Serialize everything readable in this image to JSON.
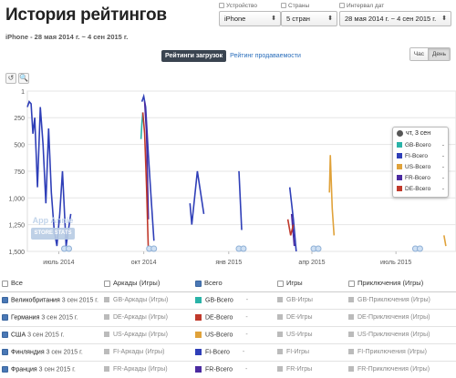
{
  "header": {
    "title": "История рейтингов",
    "subtitle": "iPhone - 28 мая 2014 г. ~ 4 сен 2015 г."
  },
  "filters": {
    "device": {
      "label": "Устройство",
      "value": "iPhone"
    },
    "countries": {
      "label": "Страны",
      "value": "5 стран"
    },
    "dates": {
      "label": "Интервал дат",
      "value": "28 мая 2014 г. ~ 4 сен 2015 г."
    }
  },
  "tabs": {
    "downloads": "Рейтинги загрузок",
    "sales": "Рейтинг продаваемости"
  },
  "period": {
    "hour": "Час",
    "day": "День"
  },
  "tools": {
    "reset": "↺",
    "zoom": "🔍"
  },
  "watermark": {
    "line1": "App Annie",
    "line2": "STORE STATS"
  },
  "legend": {
    "title": "чт, 3 сен",
    "items": [
      {
        "label": "GB-Всего",
        "value": "-",
        "color": "#2ab3a8"
      },
      {
        "label": "FI-Всего",
        "value": "-",
        "color": "#2f3fb8"
      },
      {
        "label": "US-Всего",
        "value": "-",
        "color": "#e0a23a"
      },
      {
        "label": "FR-Всего",
        "value": "-",
        "color": "#4b2aa0"
      },
      {
        "label": "DE-Всего",
        "value": "-",
        "color": "#c0392b"
      }
    ]
  },
  "chart_data": {
    "type": "line",
    "y_ticks": [
      "1",
      "250",
      "500",
      "750",
      "1,000",
      "1,250",
      "1,500"
    ],
    "ylim": [
      1,
      1500
    ],
    "y_inverted": true,
    "x_ticks": [
      "июль 2014",
      "окт 2014",
      "янв 2015",
      "апр 2015",
      "июль 2015"
    ],
    "xlim": [
      "2014-05-28",
      "2015-09-04"
    ],
    "series": [
      {
        "name": "GB-Всего",
        "color": "#2ab3a8",
        "points": [
          [
            "2014-09-28",
            450
          ],
          [
            "2014-09-29",
            300
          ],
          [
            "2014-09-30",
            200
          ]
        ]
      },
      {
        "name": "FI-Всего",
        "color": "#2f3fb8",
        "points": [
          [
            "2014-05-28",
            150
          ],
          [
            "2014-05-30",
            100
          ],
          [
            "2014-06-01",
            120
          ],
          [
            "2014-06-03",
            400
          ],
          [
            "2014-06-05",
            250
          ],
          [
            "2014-06-08",
            900
          ],
          [
            "2014-06-11",
            150
          ],
          [
            "2014-06-14",
            500
          ],
          [
            "2014-06-17",
            1050
          ],
          [
            "2014-06-20",
            350
          ],
          [
            "2014-06-23",
            950
          ],
          [
            "2014-06-26",
            1300
          ],
          [
            "2014-06-29",
            1450
          ],
          [
            "2014-07-02",
            1150
          ],
          [
            "2014-07-05",
            750
          ],
          [
            "2014-07-09",
            1450
          ],
          [
            "2014-07-14",
            1150
          ],
          [
            "2014-09-29",
            100
          ],
          [
            "2014-10-01",
            50
          ],
          [
            "2014-10-03",
            150
          ],
          [
            "2014-10-06",
            600
          ],
          [
            "2014-10-09",
            1000
          ],
          [
            "2014-10-12",
            1400
          ],
          [
            "2014-11-20",
            1050
          ],
          [
            "2014-11-22",
            1250
          ],
          [
            "2014-11-28",
            750
          ],
          [
            "2014-12-05",
            1150
          ],
          [
            "2014-12-24",
            950
          ],
          [
            "2015-01-12",
            750
          ],
          [
            "2015-01-15",
            1300
          ],
          [
            "2015-03-08",
            900
          ],
          [
            "2015-03-12",
            1200
          ],
          [
            "2015-03-15",
            1500
          ]
        ]
      },
      {
        "name": "US-Всего",
        "color": "#e0a23a",
        "points": [
          [
            "2015-04-20",
            950
          ],
          [
            "2015-04-21",
            600
          ],
          [
            "2015-04-23",
            1100
          ],
          [
            "2015-04-25",
            1350
          ],
          [
            "2015-08-22",
            1350
          ],
          [
            "2015-08-24",
            1450
          ]
        ]
      },
      {
        "name": "FR-Всего",
        "color": "#4b2aa0",
        "points": [
          [
            "2014-10-02",
            100
          ],
          [
            "2014-10-04",
            400
          ],
          [
            "2014-10-06",
            1200
          ],
          [
            "2015-03-10",
            1150
          ],
          [
            "2015-03-13",
            1450
          ]
        ]
      },
      {
        "name": "DE-Всего",
        "color": "#c0392b",
        "points": [
          [
            "2014-09-30",
            200
          ],
          [
            "2014-10-02",
            400
          ],
          [
            "2014-10-04",
            900
          ],
          [
            "2014-10-06",
            1500
          ],
          [
            "2015-03-06",
            1200
          ],
          [
            "2015-03-09",
            1350
          ],
          [
            "2015-03-12",
            1250
          ]
        ]
      }
    ],
    "markers_dates": [
      "2014-07-07",
      "2014-10-07",
      "2015-01-12",
      "2015-04-03",
      "2015-07-22"
    ]
  },
  "table": {
    "head": {
      "all": "Все",
      "arcade": "Аркады (Игры)",
      "total": "Всего",
      "games": "Игры",
      "adventure": "Приключения (Игры)"
    },
    "rows": [
      {
        "country": "Великобритания",
        "date": "3 сен 2015 г.",
        "arcade": "GB-Аркады (Игры)",
        "total": "GB-Всего",
        "dash": "-",
        "games": "GB-Игры",
        "adventure": "GB-Приключения (Игры)",
        "color": "#2ab3a8"
      },
      {
        "country": "Германия",
        "date": "3 сен 2015 г.",
        "arcade": "DE-Аркады (Игры)",
        "total": "DE-Всего",
        "dash": "-",
        "games": "DE-Игры",
        "adventure": "DE-Приключения (Игры)",
        "color": "#c0392b"
      },
      {
        "country": "США",
        "date": "3 сен 2015 г.",
        "arcade": "US-Аркады (Игры)",
        "total": "US-Всего",
        "dash": "-",
        "games": "US-Игры",
        "adventure": "US-Приключения (Игры)",
        "color": "#e0a23a"
      },
      {
        "country": "Финляндия",
        "date": "3 сен 2015 г.",
        "arcade": "FI-Аркады (Игры)",
        "total": "FI-Всего",
        "dash": "-",
        "games": "FI-Игры",
        "adventure": "FI-Приключения (Игры)",
        "color": "#2f3fb8"
      },
      {
        "country": "Франция",
        "date": "3 сен 2015 г.",
        "arcade": "FR-Аркады (Игры)",
        "total": "FR-Всего",
        "dash": "-",
        "games": "FR-Игры",
        "adventure": "FR-Приключения (Игры)",
        "color": "#4b2aa0"
      }
    ]
  }
}
